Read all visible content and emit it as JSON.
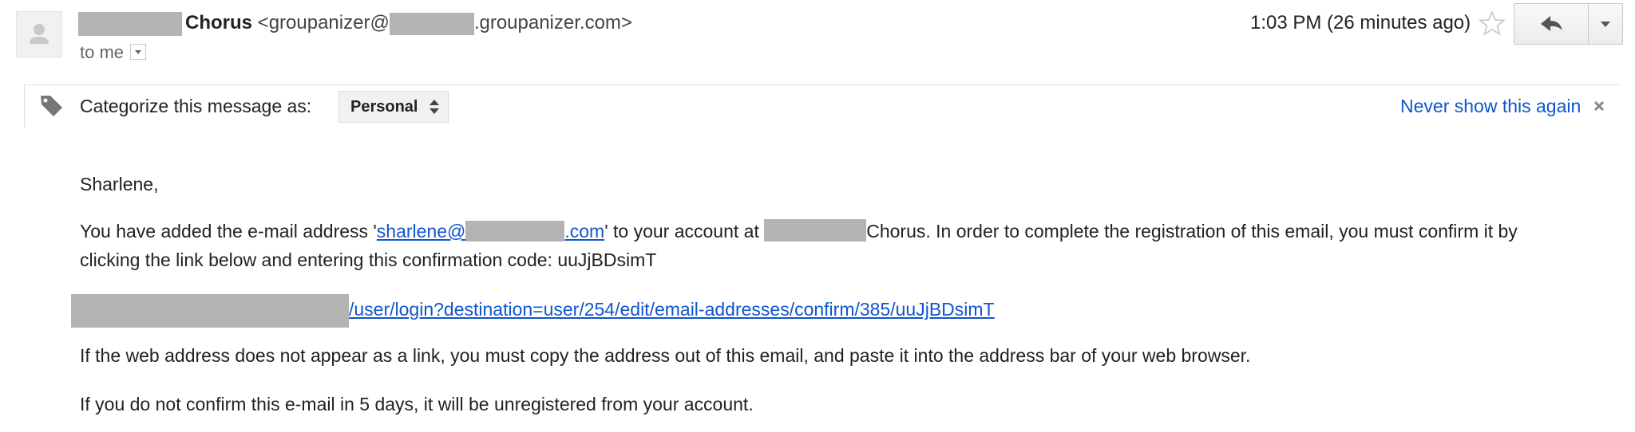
{
  "header": {
    "sender_name": "Chorus",
    "sender_email_open": "<groupanizer@",
    "sender_email_close": ".groupanizer.com>",
    "recipient": "to me",
    "timestamp": "1:03 PM (26 minutes ago)",
    "icons": [
      "avatar-icon",
      "star-icon",
      "reply-icon",
      "chevron-down-icon"
    ]
  },
  "categorize": {
    "label": "Categorize this message as:",
    "selected": "Personal",
    "never_show": "Never show this again",
    "icons": [
      "tag-icon",
      "close-icon"
    ]
  },
  "message": {
    "greeting": "Sharlene,",
    "para1_a": "You have added the e-mail address '",
    "email_link_a": "sharlene@",
    "email_link_b": ".com",
    "para1_b": "' to your account at ",
    "para1_c": "Chorus. In order to complete the registration of this email, you must confirm it by",
    "para1_line2": "clicking the link below and entering this confirmation code: uuJjBDsimT",
    "confirm_link": "/user/login?destination=user/254/edit/email-addresses/confirm/385/uuJjBDsimT",
    "para2": "If the web address does not appear as a link, you must copy the address out of this email, and paste it into the address bar of your web browser.",
    "para3": "If you do not confirm this e-mail in 5 days, it will be unregistered from your account."
  },
  "colors": {
    "link": "#1155cc",
    "redaction": "#b3b3b3",
    "text": "#222222"
  }
}
